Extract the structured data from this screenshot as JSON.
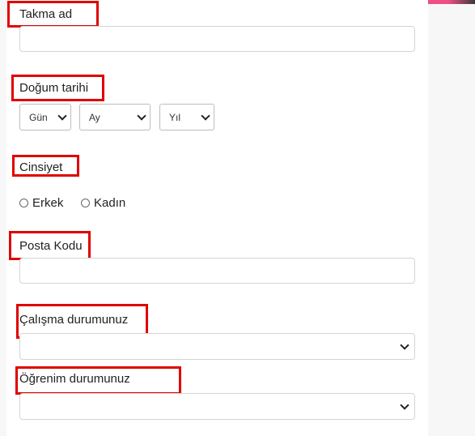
{
  "form": {
    "nickname": {
      "label": "Takma ad",
      "value": ""
    },
    "birthdate": {
      "label": "Doğum tarihi",
      "day_select": "Gün",
      "month_select": "Ay",
      "year_select": "Yıl"
    },
    "gender": {
      "label": "Cinsiyet",
      "options": [
        "Erkek",
        "Kadın"
      ],
      "selected": null
    },
    "postal_code": {
      "label": "Posta Kodu",
      "value": ""
    },
    "employment_status": {
      "label": "Çalışma durumunuz",
      "selected": ""
    },
    "education_status": {
      "label": "Öğrenim durumunuz",
      "selected": ""
    }
  },
  "highlight_color": "#e00000",
  "icons": {
    "dropdown": "chevron-down-icon",
    "radio": "radio-unchecked-icon"
  }
}
